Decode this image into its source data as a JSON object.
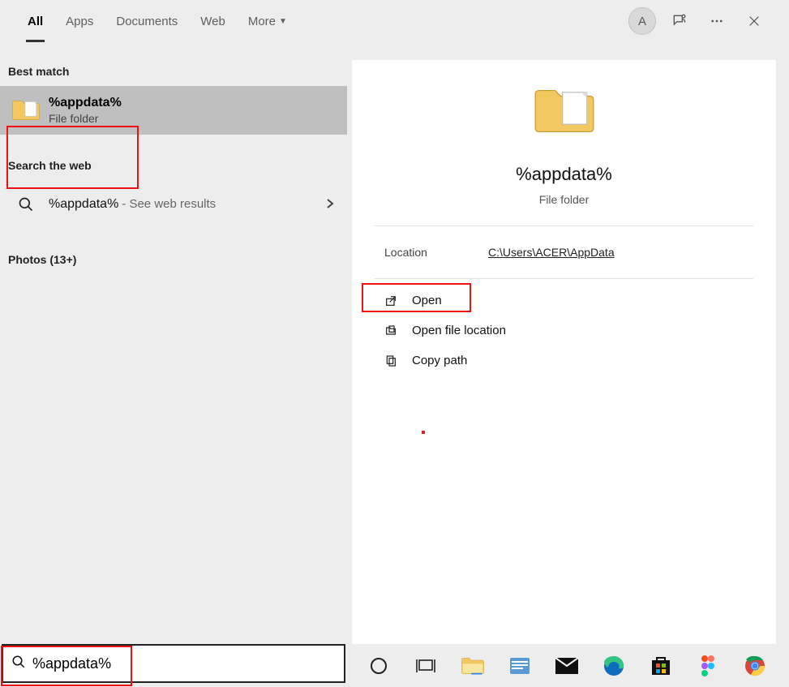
{
  "tabs": {
    "all": "All",
    "apps": "Apps",
    "documents": "Documents",
    "web": "Web",
    "more": "More"
  },
  "avatar_letter": "A",
  "sections": {
    "best_match": "Best match",
    "search_web": "Search the web",
    "photos": "Photos (13+)"
  },
  "best_match_item": {
    "title": "%appdata%",
    "subtitle": "File folder"
  },
  "web_item": {
    "title": "%appdata%",
    "suffix": " - See web results"
  },
  "detail": {
    "title": "%appdata%",
    "subtitle": "File folder",
    "kv": {
      "key": "Location",
      "value": "C:\\Users\\ACER\\AppData"
    },
    "actions": {
      "open": "Open",
      "open_loc": "Open file location",
      "copy_path": "Copy path"
    }
  },
  "search_value": "%appdata%",
  "icons": {
    "folder": "folder-icon",
    "search": "search-icon",
    "chevron_right": "chevron-right-icon",
    "chevron_down": "chevron-down-icon",
    "feedback": "feedback-icon",
    "more": "more-icon",
    "close": "close-icon",
    "open_external": "open-external-icon",
    "location_folder": "location-folder-icon",
    "copy": "copy-icon",
    "cortana": "cortana-icon",
    "task_view": "task-view-icon",
    "explorer": "file-explorer-icon",
    "word": "word-icon",
    "mail": "mail-icon",
    "edge": "edge-icon",
    "store": "ms-store-icon",
    "figma": "figma-icon",
    "chrome": "chrome-icon"
  }
}
